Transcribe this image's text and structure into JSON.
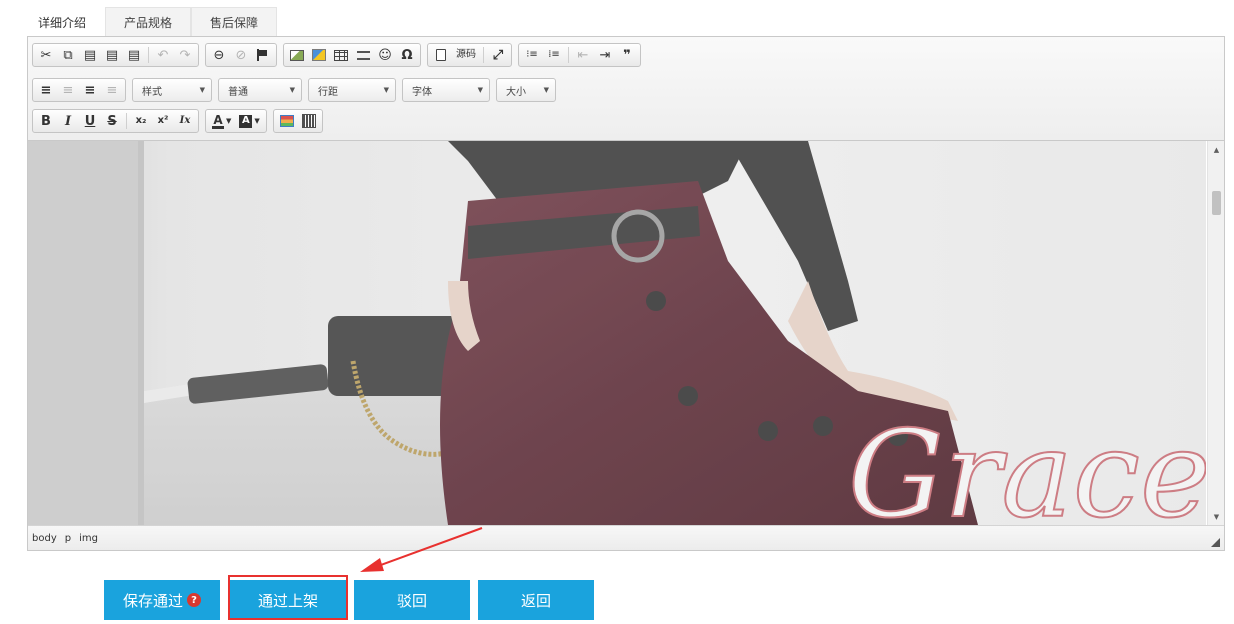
{
  "tabs": [
    {
      "label": "详细介绍",
      "active": true
    },
    {
      "label": "产品规格",
      "active": false
    },
    {
      "label": "售后保障",
      "active": false
    }
  ],
  "toolbar": {
    "row1": {
      "cut": "✂",
      "copy": "⧉",
      "paste": "▤",
      "paste_text": "▤",
      "paste_word": "▤",
      "undo": "↶",
      "redo": "↷",
      "link": "⊖",
      "unlink": "⊘",
      "smiley": "☺",
      "special_char": "Ω",
      "source_label": "源码",
      "maximize": "⤢",
      "numbered_list": "⁝≡",
      "bullet_list": "⁞≡",
      "outdent": "⇤",
      "indent": "⇥",
      "blockquote": "❞"
    },
    "row2": {
      "align_left": "≡",
      "align_center": "≡",
      "align_right": "≡",
      "justify": "≡",
      "style_label": "样式",
      "format_label": "普通",
      "line_height_label": "行距",
      "font_label": "字体",
      "size_label": "大小"
    },
    "row3": {
      "bold": "B",
      "italic": "I",
      "underline": "U",
      "strike": "S",
      "subscript": "x₂",
      "superscript": "x²",
      "remove_format": "Ix",
      "text_color": "A",
      "bg_color": "A"
    }
  },
  "content": {
    "watermark_text": "Grace"
  },
  "statusbar": {
    "path": [
      "body",
      "p",
      "img"
    ]
  },
  "actions": {
    "save_pass_label": "保存通过",
    "help_glyph": "?",
    "pass_publish_label": "通过上架",
    "reject_label": "驳回",
    "back_label": "返回"
  },
  "colors": {
    "accent": "#1aa3dd",
    "highlight": "#e8312f"
  }
}
